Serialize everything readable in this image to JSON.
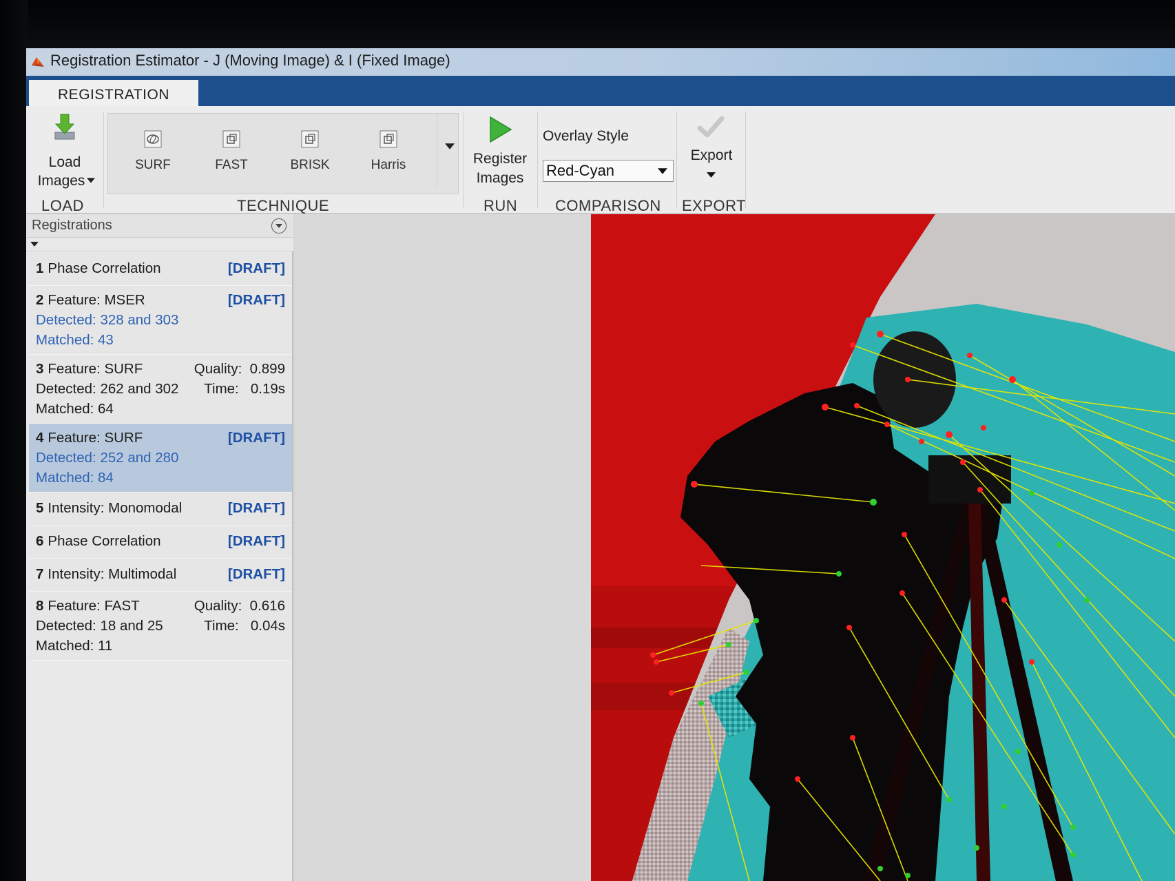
{
  "window": {
    "title": "Registration Estimator - J (Moving Image) & I (Fixed Image)"
  },
  "tabs": [
    {
      "label": "REGISTRATION"
    }
  ],
  "toolstrip": {
    "load": {
      "button_line1": "Load",
      "button_line2": "Images",
      "group_label": "LOAD"
    },
    "technique": {
      "items": [
        {
          "label": "SURF"
        },
        {
          "label": "FAST"
        },
        {
          "label": "BRISK"
        },
        {
          "label": "Harris"
        }
      ],
      "group_label": "TECHNIQUE"
    },
    "run": {
      "button_line1": "Register",
      "button_line2": "Images",
      "group_label": "RUN"
    },
    "comparison": {
      "overlay_label": "Overlay Style",
      "overlay_value": "Red-Cyan",
      "group_label": "COMPARISON"
    },
    "export": {
      "button_label": "Export",
      "group_label": "EXPORT"
    }
  },
  "registrations": {
    "header": "Registrations",
    "items": [
      {
        "num": "1",
        "title": "Phase Correlation",
        "status": "[DRAFT]"
      },
      {
        "num": "2",
        "title": "Feature: MSER",
        "status": "[DRAFT]",
        "detected": "Detected: 328 and 303",
        "matched": "Matched: 43"
      },
      {
        "num": "3",
        "title": "Feature: SURF",
        "quality": "Quality:  0.899",
        "detected": "Detected: 262 and 302",
        "time": "Time:   0.19s",
        "matched": "Matched: 64"
      },
      {
        "num": "4",
        "title": "Feature: SURF",
        "status": "[DRAFT]",
        "detected": "Detected: 252 and 280",
        "matched": "Matched: 84"
      },
      {
        "num": "5",
        "title": "Intensity: Monomodal",
        "status": "[DRAFT]"
      },
      {
        "num": "6",
        "title": "Phase Correlation",
        "status": "[DRAFT]"
      },
      {
        "num": "7",
        "title": "Intensity: Multimodal",
        "status": "[DRAFT]"
      },
      {
        "num": "8",
        "title": "Feature: FAST",
        "quality": "Quality:  0.616",
        "detected": "Detected: 18 and 25",
        "time": "Time:   0.04s",
        "matched": "Matched: 11"
      }
    ]
  },
  "colors": {
    "tabstrip": "#1e4f8d",
    "draft": "#1f4fa3",
    "overlay_red": "#c90f10",
    "overlay_cyan": "#2fb3b3",
    "match_line": "#e6e600",
    "fixed_point": "#ff2020",
    "moving_point": "#30d030"
  },
  "icons": {
    "load": "load-images-icon",
    "run": "play-icon",
    "export": "checkmark-icon"
  }
}
